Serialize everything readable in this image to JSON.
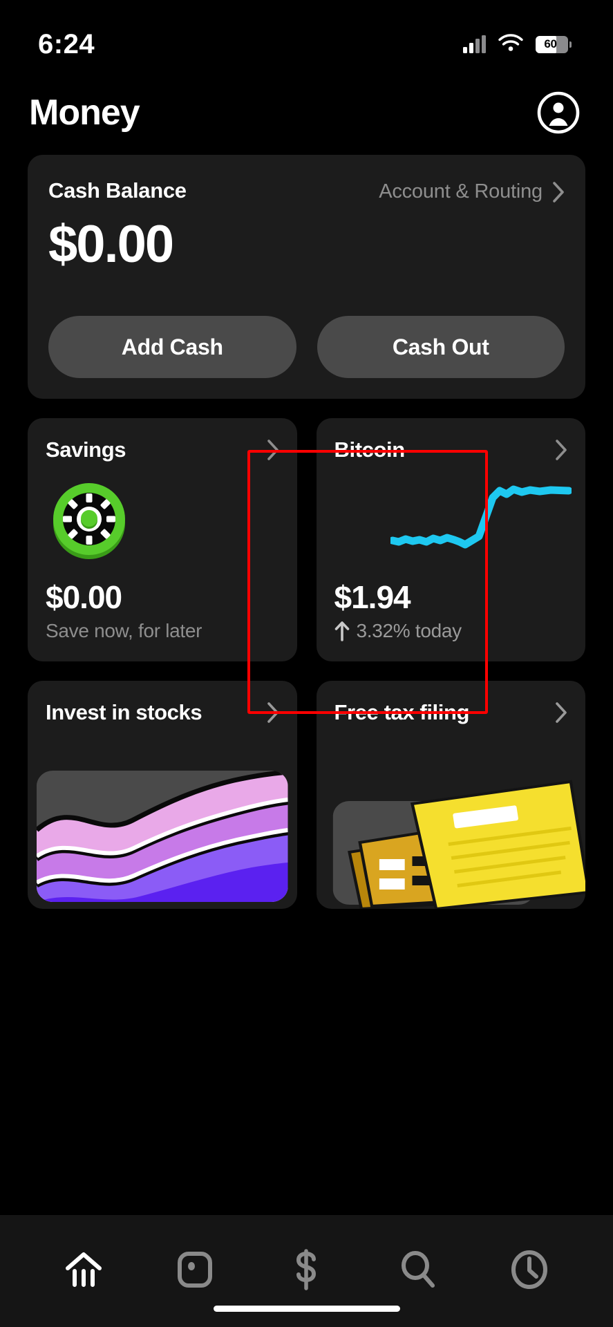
{
  "status_bar": {
    "time": "6:24",
    "battery_percent": "60",
    "icons": [
      "cellular-signal-icon",
      "wifi-icon",
      "battery-icon"
    ]
  },
  "header": {
    "title": "Money",
    "profile_icon": "account-circle-icon"
  },
  "cash_balance_card": {
    "label": "Cash Balance",
    "account_routing_label": "Account & Routing",
    "chevron_icon": "chevron-right-icon",
    "amount": "$0.00",
    "add_cash_label": "Add Cash",
    "cash_out_label": "Cash Out"
  },
  "savings_tile": {
    "title": "Savings",
    "chevron_icon": "chevron-right-icon",
    "icon": "savings-vault-icon",
    "amount": "$0.00",
    "subtitle": "Save now, for later",
    "accent_color": "#4ec526"
  },
  "bitcoin_tile": {
    "title": "Bitcoin",
    "chevron_icon": "chevron-right-icon",
    "amount": "$1.94",
    "trend_icon": "arrow-up-icon",
    "change": "3.32% today",
    "chart_color": "#1ec8f0",
    "highlight_color": "#ff0000",
    "highlighted": true
  },
  "invest_tile": {
    "title": "Invest in stocks",
    "chevron_icon": "chevron-right-icon",
    "art": "stock-chart-illustration"
  },
  "tax_tile": {
    "title": "Free tax filing",
    "chevron_icon": "chevron-right-icon",
    "art": "tax-documents-illustration"
  },
  "tab_bar": {
    "items": [
      {
        "name": "tab-banking",
        "icon": "bank-home-icon",
        "active": true
      },
      {
        "name": "tab-card",
        "icon": "card-icon",
        "active": false
      },
      {
        "name": "tab-payments",
        "icon": "dollar-sign-icon",
        "active": false
      },
      {
        "name": "tab-search",
        "icon": "search-icon",
        "active": false
      },
      {
        "name": "tab-activity",
        "icon": "clock-icon",
        "active": false
      }
    ]
  },
  "chart_data": {
    "type": "line",
    "title": "Bitcoin price sparkline",
    "xlabel": "",
    "ylabel": "",
    "series": [
      {
        "name": "Bitcoin",
        "color": "#1ec8f0",
        "values": [
          32,
          30,
          34,
          31,
          33,
          30,
          35,
          33,
          36,
          34,
          31,
          28,
          32,
          36,
          60,
          80,
          88,
          84,
          89,
          86,
          88,
          87,
          88
        ]
      }
    ],
    "ylim": [
      0,
      100
    ],
    "grid": false,
    "legend": "none"
  }
}
